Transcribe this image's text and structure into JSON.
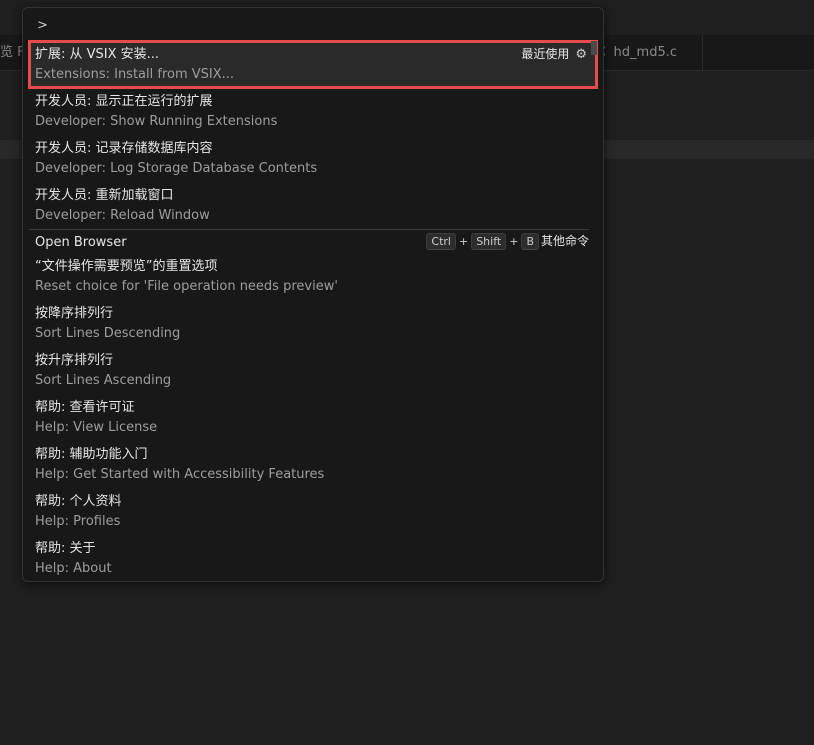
{
  "background_tabs": {
    "left_tab_label": "览 F",
    "right_tab_icon": "c-file-icon",
    "right_tab_icon_glyph": "C",
    "right_tab_label": "hd_md5.c"
  },
  "palette": {
    "input_value": ">",
    "recent_label": "最近使用",
    "other_commands_label": "其他命令",
    "keybinding": [
      "Ctrl",
      "Shift",
      "B"
    ],
    "items": [
      {
        "label": "扩展: 从 VSIX 安装...",
        "detail": "Extensions: Install from VSIX..."
      },
      {
        "label": "开发人员: 显示正在运行的扩展",
        "detail": "Developer: Show Running Extensions"
      },
      {
        "label": "开发人员: 记录存储数据库内容",
        "detail": "Developer: Log Storage Database Contents"
      },
      {
        "label": "开发人员: 重新加载窗口",
        "detail": "Developer: Reload Window"
      },
      {
        "label": "Open Browser"
      },
      {
        "label": "“文件操作需要预览”的重置选项",
        "detail": "Reset choice for 'File operation needs preview'"
      },
      {
        "label": "按降序排列行",
        "detail": "Sort Lines Descending"
      },
      {
        "label": "按升序排列行",
        "detail": "Sort Lines Ascending"
      },
      {
        "label": "帮助: 查看许可证",
        "detail": "Help: View License"
      },
      {
        "label": "帮助: 辅助功能入门",
        "detail": "Help: Get Started with Accessibility Features"
      },
      {
        "label": "帮助: 个人资料",
        "detail": "Help: Profiles"
      },
      {
        "label": "帮助: 关于",
        "detail": "Help: About"
      }
    ]
  },
  "colors": {
    "selection_outline": "#e74c4c",
    "palette_bg": "#181818",
    "editor_bg": "#1f1f1f"
  }
}
